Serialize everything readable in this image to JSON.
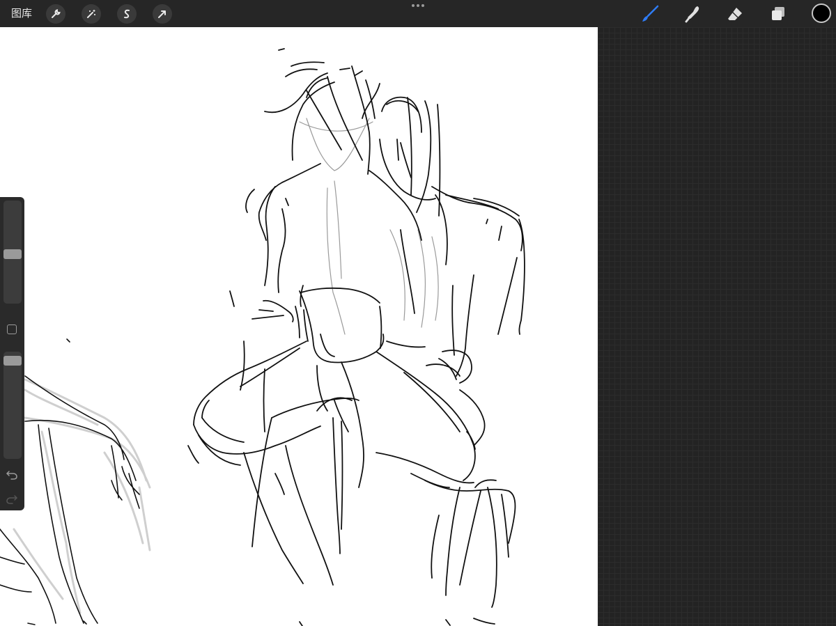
{
  "toolbar": {
    "gallery_label": "图库",
    "left_tools": [
      "wrench-icon",
      "magic-wand-icon",
      "selection-s-icon",
      "transform-arrow-icon"
    ],
    "right_tools": [
      "brush-icon",
      "smudge-icon",
      "eraser-icon",
      "layers-icon"
    ],
    "active_tool": "brush-icon",
    "accent_color": "#2f7cf6",
    "current_color": "#000000"
  },
  "sidebar": {
    "brush_size": 0.5,
    "opacity": 1.0,
    "controls": [
      "brush-size-slider",
      "modify-button",
      "opacity-slider",
      "undo-icon",
      "redo-icon"
    ]
  },
  "canvas": {
    "background": "#ffffff",
    "content": "pencil sketch"
  }
}
